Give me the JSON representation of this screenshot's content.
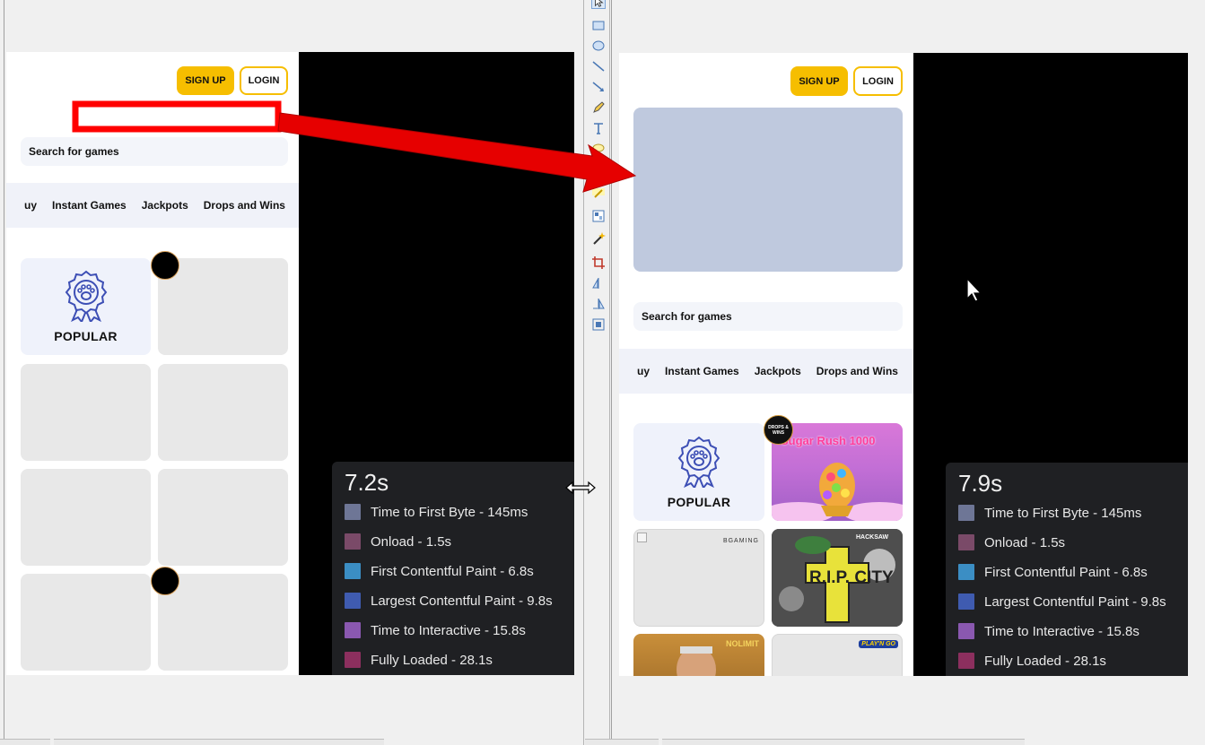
{
  "left": {
    "header": {
      "signup": "SIGN UP",
      "login": "LOGIN"
    },
    "search_label": "Search for games",
    "categories": [
      "uy",
      "Instant Games",
      "Jackpots",
      "Drops and Wins"
    ],
    "popular_label": "POPULAR",
    "perf": {
      "total": "7.2s",
      "metrics": [
        {
          "label": "Time to First Byte - 145ms",
          "color": "#6e7696"
        },
        {
          "label": "Onload - 1.5s",
          "color": "#7a4a68"
        },
        {
          "label": "First Contentful Paint - 6.8s",
          "color": "#3b8ec4"
        },
        {
          "label": "Largest Contentful Paint - 9.8s",
          "color": "#3f5bb0"
        },
        {
          "label": "Time to Interactive - 15.8s",
          "color": "#8a58b0"
        },
        {
          "label": "Fully Loaded - 28.1s",
          "color": "#8c2f5e"
        }
      ]
    }
  },
  "right": {
    "header": {
      "signup": "SIGN UP",
      "login": "LOGIN"
    },
    "search_label": "Search for games",
    "categories": [
      "uy",
      "Instant Games",
      "Jackpots",
      "Drops and Wins"
    ],
    "popular_label": "POPULAR",
    "badge": "DROPS & WINS",
    "games": {
      "sugar_rush": "Sugar Rush 1000",
      "bgaming": "BGAMING",
      "rip_city": "R.I.P. CITY",
      "hacksaw": "HACKSAW",
      "nolimit": "NOLIMIT",
      "playngo": "PLAY'N GO"
    },
    "perf": {
      "total": "7.9s",
      "metrics": [
        {
          "label": "Time to First Byte - 145ms",
          "color": "#6e7696"
        },
        {
          "label": "Onload - 1.5s",
          "color": "#7a4a68"
        },
        {
          "label": "First Contentful Paint - 6.8s",
          "color": "#3b8ec4"
        },
        {
          "label": "Largest Contentful Paint - 9.8s",
          "color": "#3f5bb0"
        },
        {
          "label": "Time to Interactive - 15.8s",
          "color": "#8a58b0"
        },
        {
          "label": "Fully Loaded - 28.1s",
          "color": "#8c2f5e"
        }
      ]
    }
  },
  "annotation": {
    "box_color": "#ff0000",
    "arrow_color": "#e00000"
  },
  "tools": [
    "select-icon",
    "rectangle-icon",
    "ellipse-icon",
    "line-icon",
    "arrow-icon",
    "pencil-icon",
    "text-icon",
    "callout-icon",
    "spellcheck-icon",
    "grid-icon",
    "magic-wand-icon",
    "crop-icon",
    "flip-icon",
    "mirror-icon",
    "fit-icon"
  ]
}
